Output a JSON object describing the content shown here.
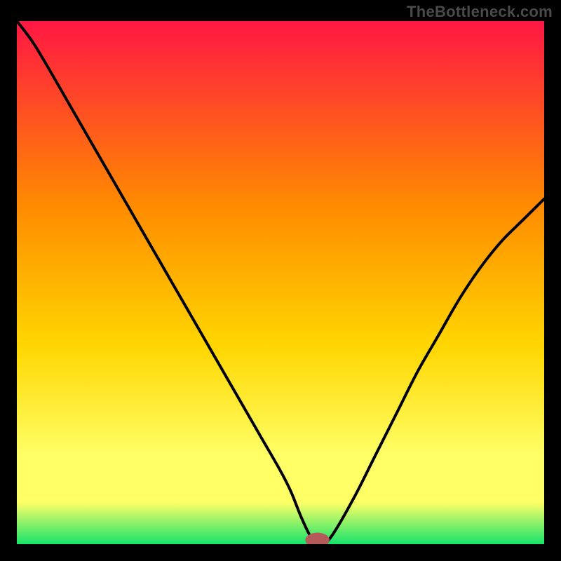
{
  "watermark": "TheBottleneck.com",
  "colors": {
    "frame": "#000000",
    "watermark": "#4a4a4a",
    "curve": "#000000",
    "marker": "#b45a5a",
    "gradient_top": "#ff1744",
    "gradient_mid1": "#ff8a00",
    "gradient_mid2": "#ffd600",
    "gradient_mid3": "#ffff66",
    "gradient_bottom": "#17e36b"
  },
  "chart_data": {
    "type": "line",
    "title": "",
    "xlabel": "",
    "ylabel": "",
    "xlim": [
      0,
      100
    ],
    "ylim": [
      0,
      100
    ],
    "grid": false,
    "legend": false,
    "x": [
      0,
      3,
      6,
      10,
      14,
      18,
      22,
      26,
      30,
      34,
      38,
      42,
      46,
      50,
      52,
      54,
      56,
      58,
      60,
      64,
      68,
      72,
      76,
      80,
      84,
      88,
      92,
      96,
      100
    ],
    "values": [
      100,
      96,
      91,
      84,
      77,
      70,
      63,
      56,
      49,
      42,
      35,
      28,
      21,
      14,
      10,
      5,
      1,
      0,
      2,
      9,
      17,
      25,
      33,
      40,
      47,
      53,
      58,
      62,
      66
    ],
    "minimum_x": 57,
    "minimum_y": 0,
    "marker": {
      "x": 57,
      "y": 0,
      "rx": 2.3,
      "ry": 1.4
    }
  }
}
